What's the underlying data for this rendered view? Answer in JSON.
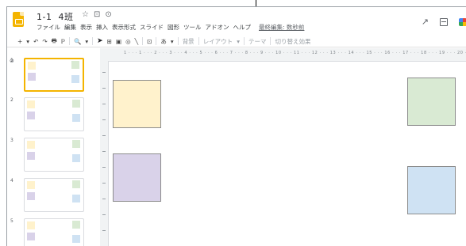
{
  "header": {
    "title": "1-1  4班",
    "menu": [
      "ファイル",
      "編集",
      "表示",
      "挿入",
      "表示形式",
      "スライド",
      "図形",
      "ツール",
      "アドオン",
      "ヘルプ"
    ],
    "last_edit": "最終編集: 数秒前"
  },
  "icons": {
    "star": "☆",
    "folder": "⊡",
    "cloud": "⊙",
    "activity": "↗",
    "comments": "comment-icon",
    "gsuite": "gsuite-icon"
  },
  "toolbar": {
    "new_slide": "+",
    "dropdown": "▾",
    "undo": "↶",
    "redo": "↷",
    "print": "🖶",
    "paint_format": "ℙ",
    "zoom": "🔍",
    "zoom_caret": "▾",
    "select": "➤",
    "textbox": "⊞",
    "image": "▣",
    "shape": "◎",
    "line": "╲",
    "comment": "⊡",
    "text_style": "あ",
    "background": "背景",
    "layout": "レイアウト",
    "theme": "テーマ",
    "transition": "切り替え効果"
  },
  "ruler": {
    "top_marks": "1 · · · 1 · · · 2 · · · 3 · · · 4 · · · 5 · · · 6 · · · 7 · · · 8 · · · 9 · · · 10 · · · 11 · · · 12 · · · 13 · · · 14 · · · 15 · · · 16 · · · 17 · · · 18 · · · 19 · · · 20 · · · 21 · · · 22 · · · 23 · · · 24 · · · 25"
  },
  "filmstrip": {
    "slides": [
      {
        "number": "1",
        "selected": true
      },
      {
        "number": "2",
        "selected": false
      },
      {
        "number": "3",
        "selected": false
      },
      {
        "number": "4",
        "selected": false
      },
      {
        "number": "5",
        "selected": false
      }
    ]
  },
  "slide": {
    "shapes": [
      {
        "name": "yellow-square",
        "color": "#fff2cc"
      },
      {
        "name": "purple-square",
        "color": "#d9d2e9"
      },
      {
        "name": "green-square",
        "color": "#d9ead3"
      },
      {
        "name": "blue-square",
        "color": "#cfe2f3"
      }
    ]
  },
  "colors": {
    "accent": "#f4b400",
    "ruler_bg": "#f1f3f4"
  }
}
